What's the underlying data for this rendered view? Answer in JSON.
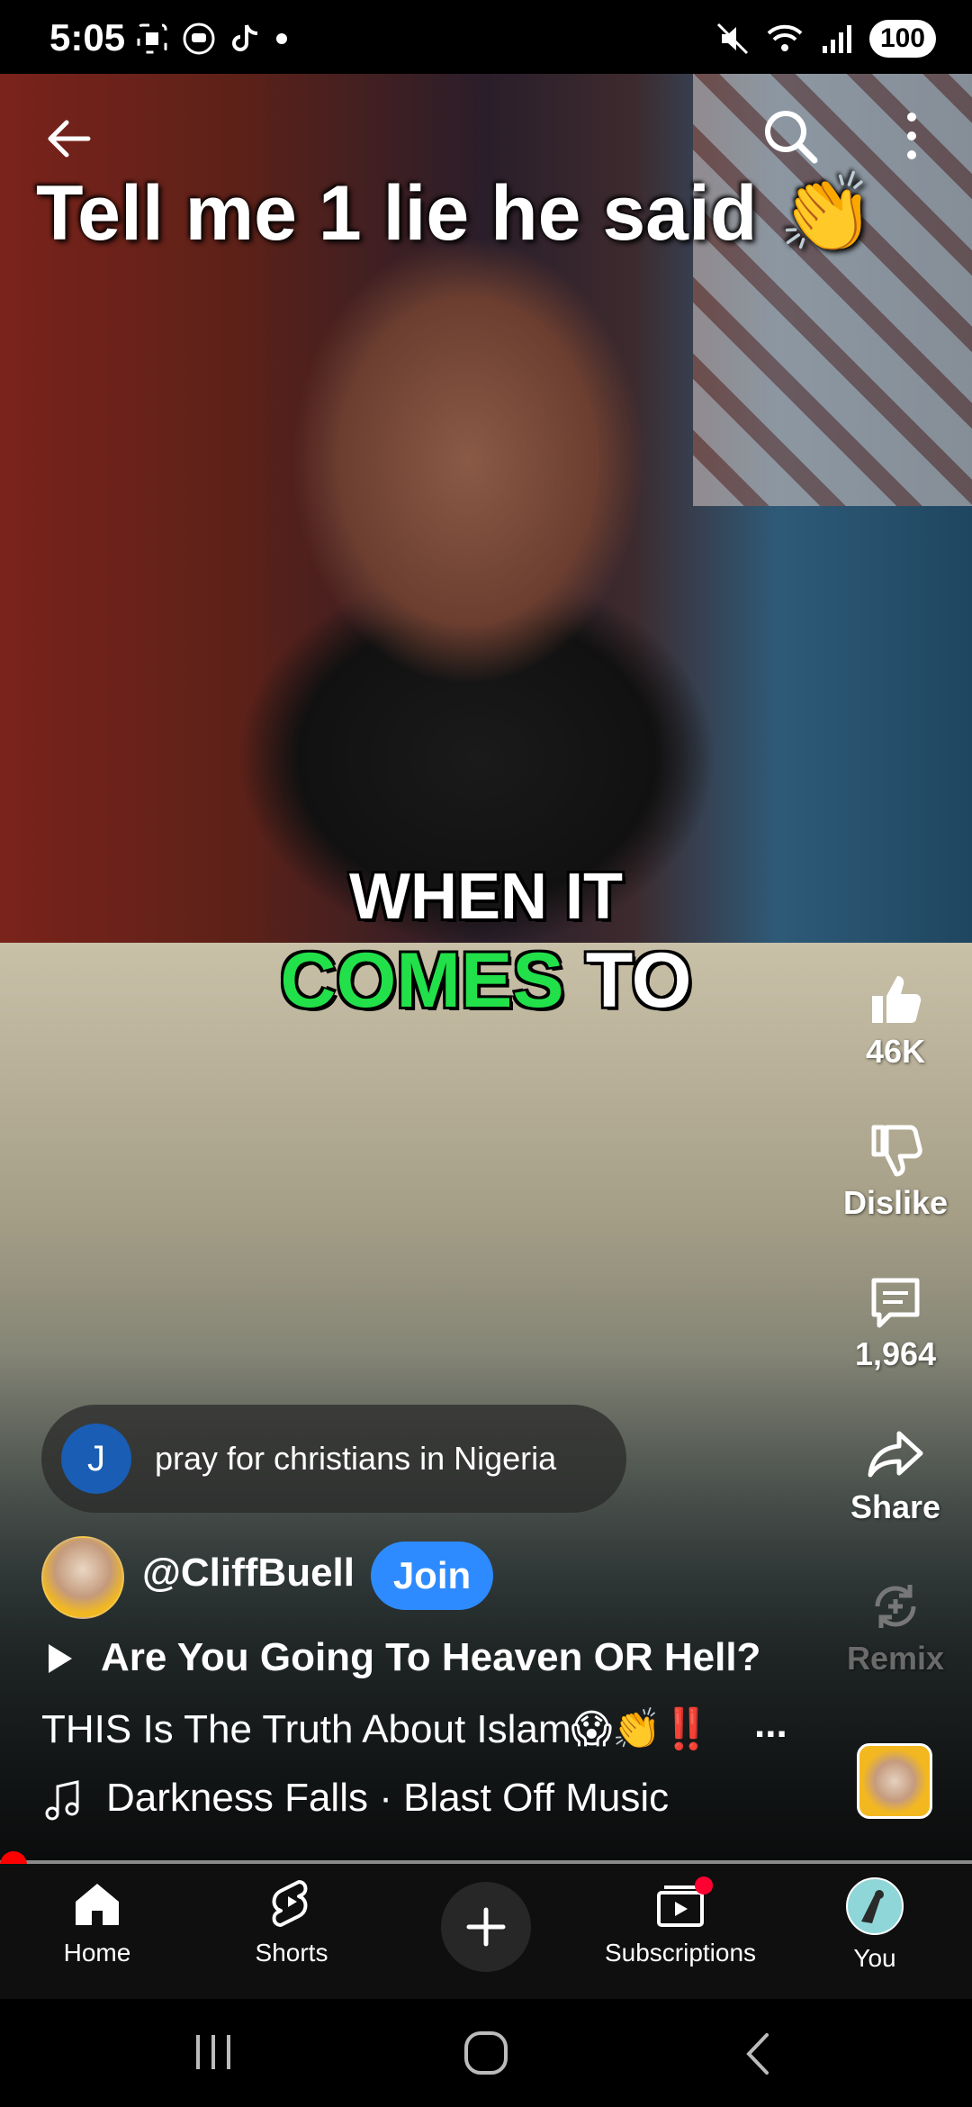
{
  "status_bar": {
    "time": "5:05",
    "battery": "100"
  },
  "video": {
    "headline": "Tell me 1 lie he said 👏",
    "caption_line1": "WHEN IT",
    "caption_green": "COMES",
    "caption_rest": " TO"
  },
  "actions": {
    "likes": "46K",
    "dislike": "Dislike",
    "comments": "1,964",
    "share": "Share",
    "remix": "Remix"
  },
  "comment": {
    "avatar_letter": "J",
    "text": "pray for christians in Nigeria"
  },
  "channel": {
    "handle": "@CliffBuell",
    "join_label": "Join"
  },
  "video_info": {
    "title_line1": "Are You Going To Heaven OR Hell?",
    "title_line2": "THIS Is The Truth About Islam😱👏‼️",
    "more": "...",
    "music": "Darkness Falls · Blast Off Music"
  },
  "nav": {
    "home": "Home",
    "shorts": "Shorts",
    "subscriptions": "Subscriptions",
    "you": "You"
  },
  "colors": {
    "join_blue": "#2e8bff",
    "caption_green": "#22e04a",
    "progress_red": "#ff0000"
  }
}
